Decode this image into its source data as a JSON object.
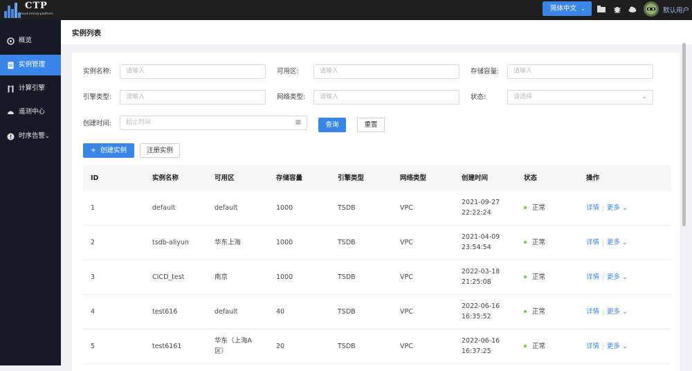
{
  "header": {
    "brand": "CTP",
    "brand_sub": "cloud-timing-platform",
    "language": "简体中文",
    "user": "默认用户",
    "accent": "#3a86e8"
  },
  "sidebar": {
    "items": [
      {
        "label": "概览",
        "icon": "dashboard-icon"
      },
      {
        "label": "实例管理",
        "icon": "document-icon",
        "active": true
      },
      {
        "label": "计算引擎",
        "icon": "compute-icon"
      },
      {
        "label": "遥测中心",
        "icon": "gauge-icon"
      },
      {
        "label": "时序告警",
        "icon": "alert-icon"
      }
    ]
  },
  "page": {
    "title": "实例列表"
  },
  "filters": {
    "instance_name": {
      "label": "实例名称:",
      "placeholder": "请输入"
    },
    "zone": {
      "label": "可用区:",
      "placeholder": "请输入"
    },
    "storage": {
      "label": "存储容量:",
      "placeholder": "请输入"
    },
    "engine": {
      "label": "引擎类型:",
      "placeholder": "请输入"
    },
    "network": {
      "label": "网络类型:",
      "placeholder": "请输入"
    },
    "status": {
      "label": "状态:",
      "placeholder": "请选择"
    },
    "created": {
      "label": "创建时间:",
      "placeholder": "起止时间"
    },
    "query_label": "查询",
    "reset_label": "重置"
  },
  "actions": {
    "create_label": "创建实例",
    "register_label": "注册实例"
  },
  "table": {
    "columns": [
      "ID",
      "实例名称",
      "可用区",
      "存储容量",
      "引擎类型",
      "网络类型",
      "创建时间",
      "状态",
      "操作"
    ],
    "rows": [
      {
        "id": "1",
        "name": "default",
        "zone": "default",
        "zone2": "",
        "storage": "1000",
        "engine": "TSDB",
        "network": "VPC",
        "date": "2021-09-27",
        "time": "22:22:24",
        "status": "正常"
      },
      {
        "id": "2",
        "name": "tsdb-aliyun",
        "zone": "华东上海",
        "zone2": "",
        "storage": "1000",
        "engine": "TSDB",
        "network": "VPC",
        "date": "2021-04-09",
        "time": "23:54:54",
        "status": "正常"
      },
      {
        "id": "3",
        "name": "CICD_test",
        "zone": "南京",
        "zone2": "",
        "storage": "1000",
        "engine": "TSDB",
        "network": "VPC",
        "date": "2022-03-18",
        "time": "21:25:08",
        "status": "正常"
      },
      {
        "id": "4",
        "name": "test616",
        "zone": "default",
        "zone2": "",
        "storage": "40",
        "engine": "TSDB",
        "network": "VPC",
        "date": "2022-06-16",
        "time": "16:35:52",
        "status": "正常"
      },
      {
        "id": "5",
        "name": "test6161",
        "zone": "华东（上海A",
        "zone2": "区）",
        "storage": "20",
        "engine": "TSDB",
        "network": "VPC",
        "date": "2022-06-16",
        "time": "16:37:25",
        "status": "正常"
      }
    ],
    "detail_label": "详情",
    "more_label": "更多"
  }
}
